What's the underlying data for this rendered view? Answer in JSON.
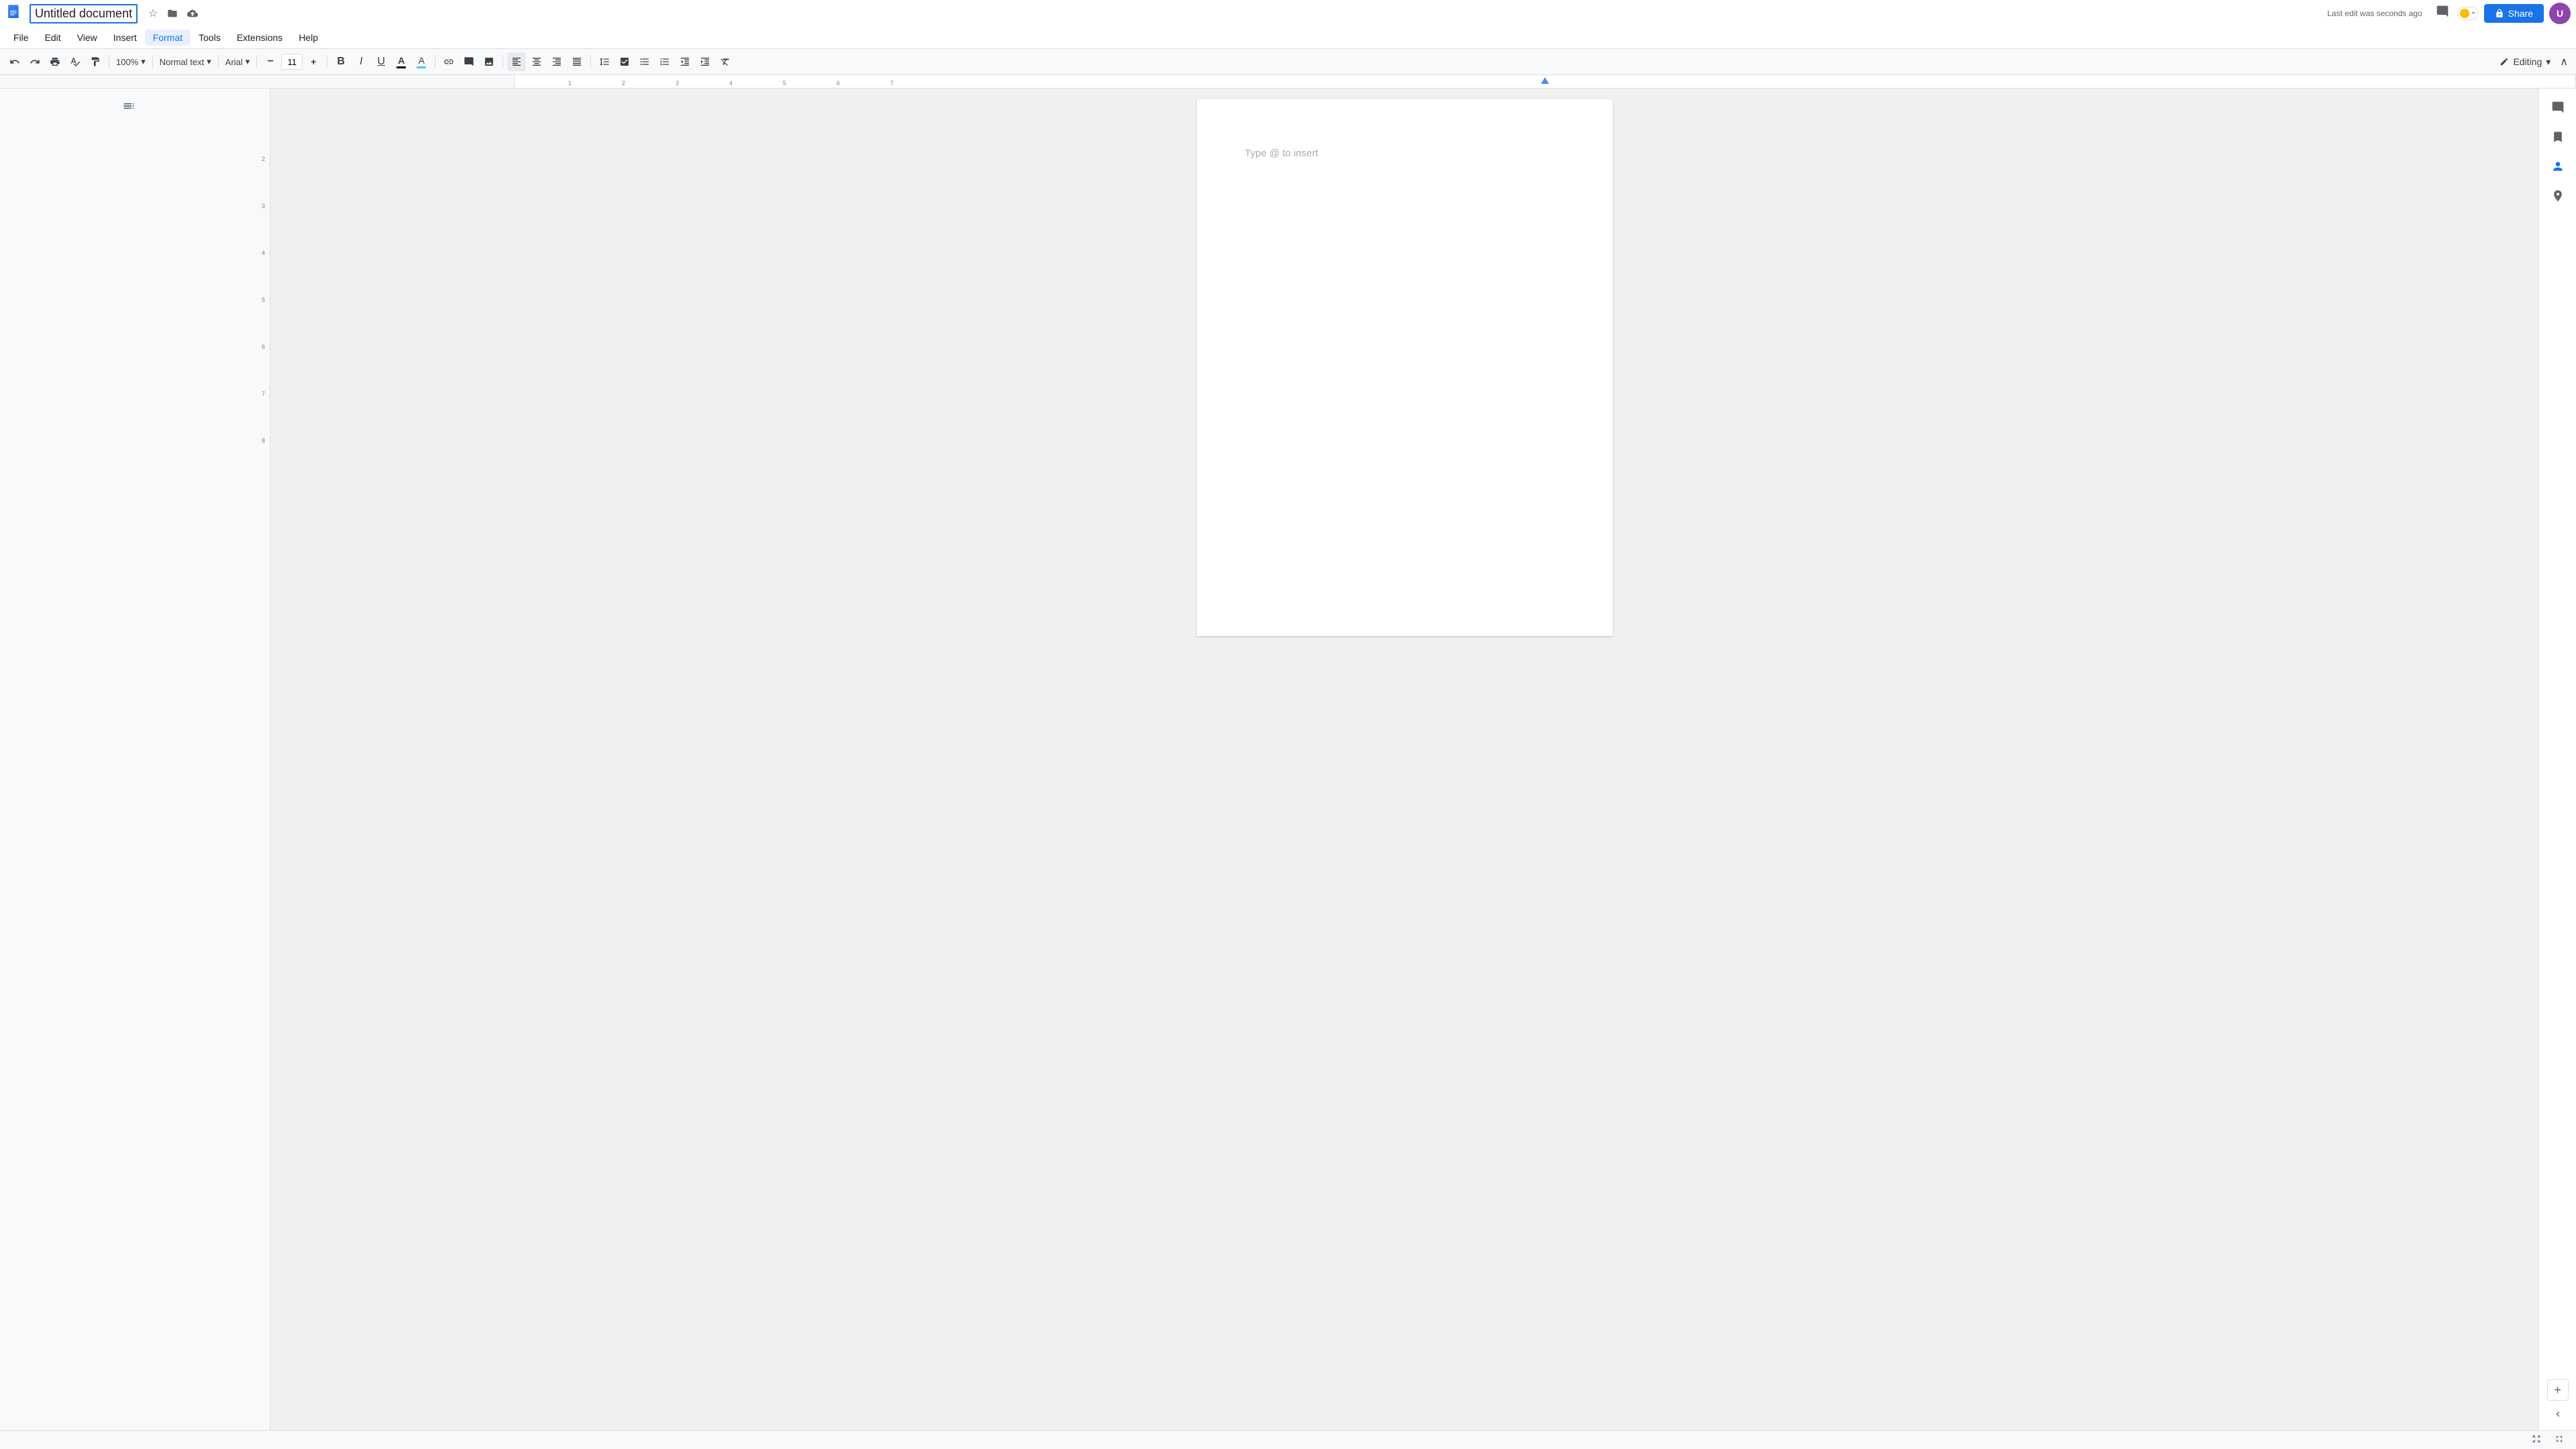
{
  "title_bar": {
    "doc_title": "Untitled document",
    "last_edit": "Last edit was seconds ago",
    "share_label": "Share",
    "share_icon": "🔒"
  },
  "menu": {
    "items": [
      "File",
      "Edit",
      "View",
      "Insert",
      "Format",
      "Tools",
      "Extensions",
      "Help"
    ]
  },
  "toolbar": {
    "undo_label": "↺",
    "redo_label": "↻",
    "print_label": "🖨",
    "paint_format_label": "🖌",
    "zoom_value": "100%",
    "style_label": "Normal text",
    "font_label": "Arial",
    "font_size": "11",
    "bold_label": "B",
    "italic_label": "I",
    "underline_label": "U",
    "text_color_label": "A",
    "highlight_label": "A",
    "link_label": "🔗",
    "comment_label": "💬",
    "image_label": "🖼",
    "align_left": "≡",
    "align_center": "≡",
    "align_right": "≡",
    "align_justify": "≡",
    "line_spacing_label": "↕",
    "checklist_label": "☑",
    "bullet_list_label": "•",
    "numbered_list_label": "#",
    "indent_less_label": "⇤",
    "indent_more_label": "⇥",
    "clear_format_label": "✗",
    "text_color_hex": "#000000",
    "highlight_hex": "#ffff00",
    "editing_label": "Editing",
    "expand_label": "∧",
    "chevron_down": "▾"
  },
  "document": {
    "placeholder": "Type @ to insert"
  },
  "sidebar": {
    "icons": [
      "💬",
      "🔖",
      "👤",
      "📍"
    ]
  },
  "ruler": {
    "marks": [
      "1",
      "2",
      "3",
      "4",
      "5",
      "6",
      "7"
    ]
  },
  "bottom": {
    "fit_btn": "⊡",
    "fullscreen_btn": "⤢"
  }
}
